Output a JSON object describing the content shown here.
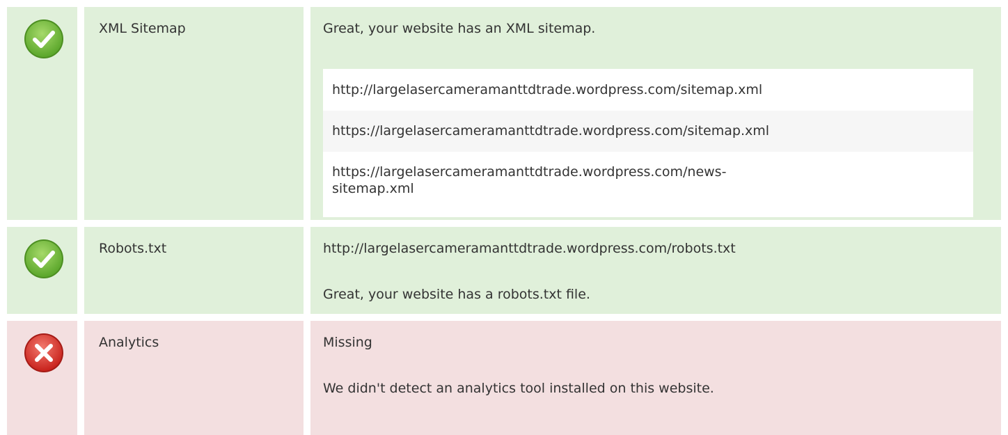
{
  "rows": [
    {
      "status": "pass",
      "icon": "check-circle-icon",
      "label": "XML Sitemap",
      "message": "Great, your website has an XML sitemap.",
      "urls": [
        "http://largelasercameramanttdtrade.wordpress.com/sitemap.xml",
        "https://largelasercameramanttdtrade.wordpress.com/sitemap.xml",
        "https://largelasercameramanttdtrade.wordpress.com/news-sitemap.xml"
      ]
    },
    {
      "status": "pass",
      "icon": "check-circle-icon",
      "label": "Robots.txt",
      "url": "http://largelasercameramanttdtrade.wordpress.com/robots.txt",
      "message": "Great, your website has a robots.txt file."
    },
    {
      "status": "fail",
      "icon": "error-circle-icon",
      "label": "Analytics",
      "value": "Missing",
      "message": "We didn't detect an analytics tool installed on this website."
    }
  ],
  "colors": {
    "pass_bg": "#e0f0da",
    "fail_bg": "#f3dfe0",
    "pass_icon": "#7cc242",
    "fail_icon": "#e0403a"
  }
}
